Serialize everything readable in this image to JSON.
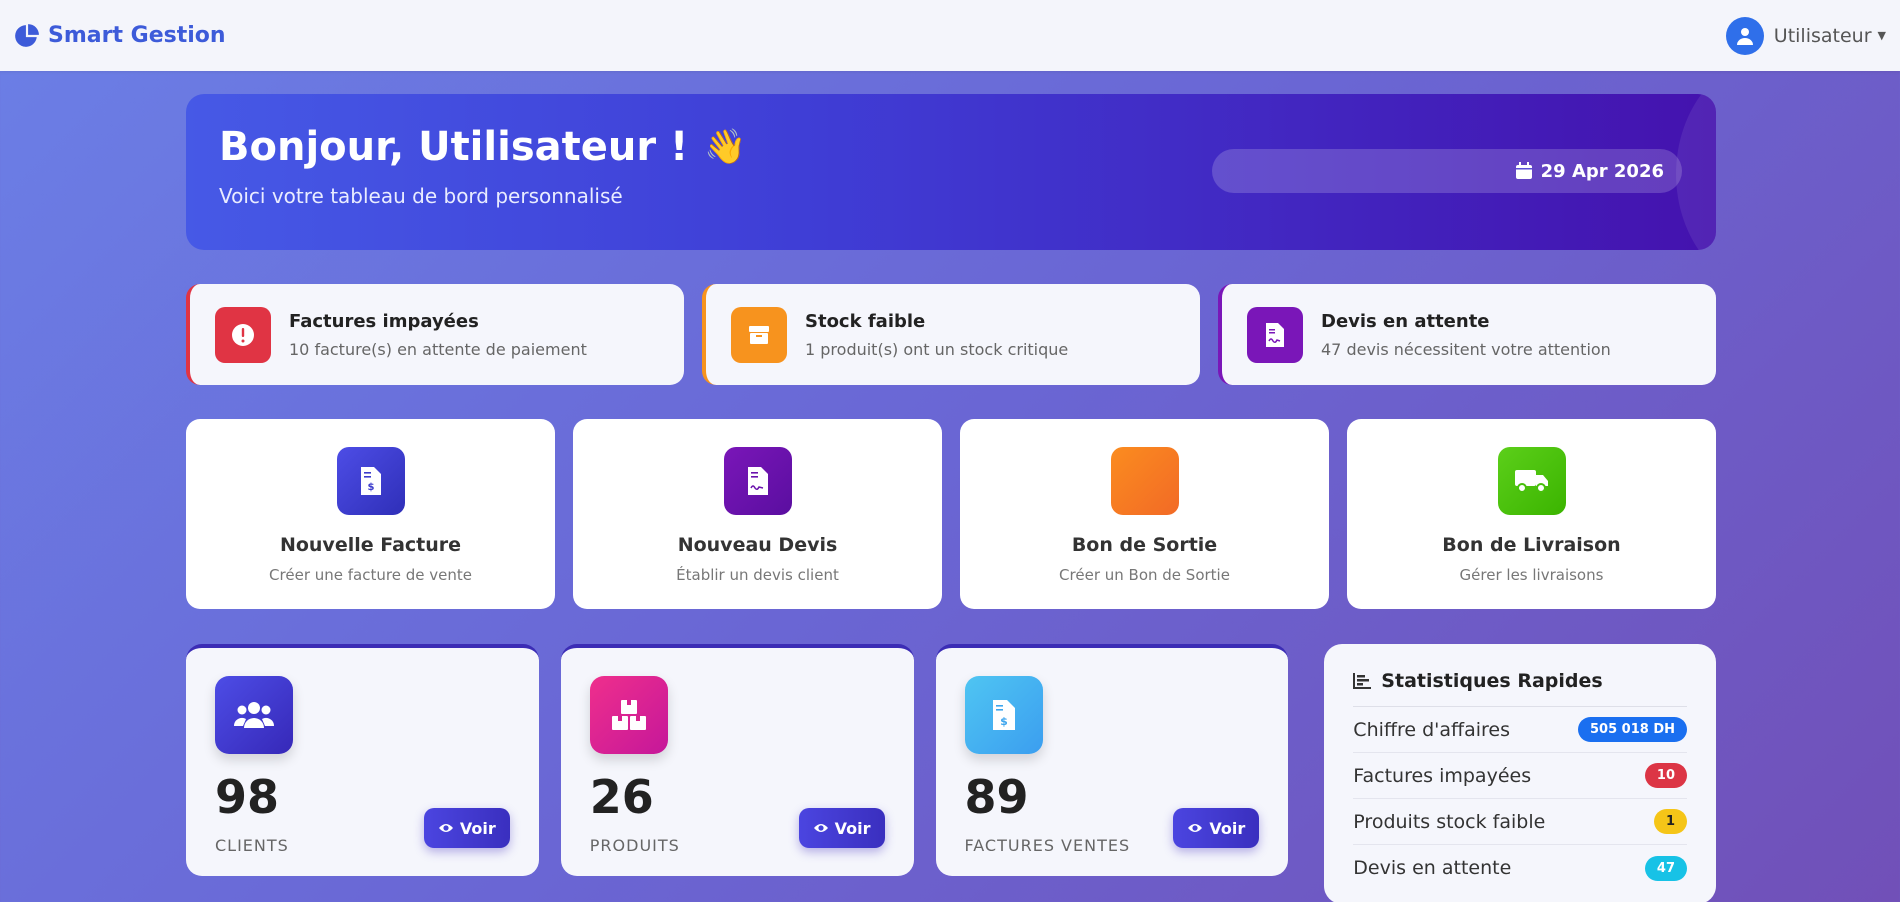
{
  "nav": {
    "brand": "Smart Gestion",
    "user": "Utilisateur"
  },
  "hero": {
    "greeting": "Bonjour, Utilisateur !",
    "wave": "👋",
    "subtitle": "Voici votre tableau de bord personnalisé",
    "date": "29 Apr 2026"
  },
  "alerts": [
    {
      "title": "Factures impayées",
      "text": "10 facture(s) en attente de paiement",
      "color": "#e03444"
    },
    {
      "title": "Stock faible",
      "text": "1 produit(s) ont un stock critique",
      "color": "#f7931e"
    },
    {
      "title": "Devis en attente",
      "text": "47 devis nécessitent votre attention",
      "color": "#7a16b8"
    }
  ],
  "actions": [
    {
      "title": "Nouvelle Facture",
      "text": "Créer une facture de vente"
    },
    {
      "title": "Nouveau Devis",
      "text": "Établir un devis client"
    },
    {
      "title": "Bon de Sortie",
      "text": "Créer un Bon de Sortie"
    },
    {
      "title": "Bon de Livraison",
      "text": "Gérer les livraisons"
    }
  ],
  "stats": [
    {
      "value": "98",
      "label": "CLIENTS",
      "button": "Voir"
    },
    {
      "value": "26",
      "label": "PRODUITS",
      "button": "Voir"
    },
    {
      "value": "89",
      "label": "FACTURES VENTES",
      "button": "Voir"
    }
  ],
  "quick": {
    "title": "Statistiques Rapides",
    "rows": [
      {
        "label": "Chiffre d'affaires",
        "value": "505 018 DH",
        "color": "#1a6ff0"
      },
      {
        "label": "Factures impayées",
        "value": "10",
        "color": "#dc3545"
      },
      {
        "label": "Produits stock faible",
        "value": "1",
        "color": "#f5c518"
      },
      {
        "label": "Devis en attente",
        "value": "47",
        "color": "#17c2e6"
      }
    ]
  }
}
